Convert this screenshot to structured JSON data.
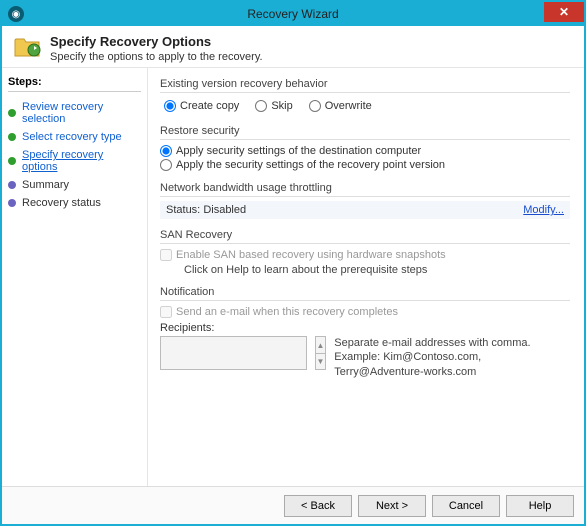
{
  "window": {
    "title": "Recovery Wizard"
  },
  "header": {
    "title": "Specify Recovery Options",
    "subtitle": "Specify the options to apply to the recovery."
  },
  "steps": {
    "title": "Steps:",
    "items": [
      {
        "label": "Review recovery selection",
        "state": "done"
      },
      {
        "label": "Select recovery type",
        "state": "done"
      },
      {
        "label": "Specify recovery options",
        "state": "current"
      },
      {
        "label": "Summary",
        "state": "pending"
      },
      {
        "label": "Recovery status",
        "state": "pending"
      }
    ]
  },
  "existing_version": {
    "title": "Existing version recovery behavior",
    "create_copy": "Create copy",
    "skip": "Skip",
    "overwrite": "Overwrite",
    "selected": "create_copy"
  },
  "restore_security": {
    "title": "Restore security",
    "dest": "Apply security settings of the destination computer",
    "point": "Apply the security settings of the recovery point version",
    "selected": "dest"
  },
  "throttling": {
    "title": "Network bandwidth usage throttling",
    "status_label": "Status:",
    "status_value": "Disabled",
    "modify": "Modify..."
  },
  "san": {
    "title": "SAN Recovery",
    "enable": "Enable SAN based recovery using hardware snapshots",
    "help": "Click on Help to learn about the prerequisite steps"
  },
  "notification": {
    "title": "Notification",
    "send": "Send an e-mail when this recovery completes",
    "recipients_label": "Recipients:",
    "hint1": "Separate e-mail addresses with comma.",
    "hint2": "Example: Kim@Contoso.com, Terry@Adventure-works.com"
  },
  "buttons": {
    "back": "< Back",
    "next": "Next >",
    "cancel": "Cancel",
    "help": "Help"
  }
}
